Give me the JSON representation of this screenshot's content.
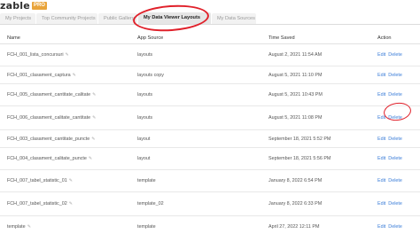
{
  "header": {
    "logo_text": "zable",
    "logo_badge": "PRO"
  },
  "tabs": [
    {
      "label": "My Projects",
      "active": false
    },
    {
      "label": "Top Community Projects",
      "active": false
    },
    {
      "label": "Public Gallery",
      "active": false
    },
    {
      "label": "My Data Viewer Layouts",
      "active": true
    },
    {
      "label": "My Data Sources",
      "active": false
    }
  ],
  "table": {
    "headers": {
      "name": "Name",
      "source": "App Source",
      "time": "Time Saved",
      "action": "Action"
    },
    "edit_label": "Edit",
    "delete_label": "Delete",
    "rows": [
      {
        "name": "FCH_001_lista_concursuri",
        "source": "layouts",
        "time": "August 2, 2021 11:54 AM"
      },
      {
        "name": "FCH_001_clasament_captura",
        "source": "layouts copy",
        "time": "August 5, 2021 11:10 PM"
      },
      {
        "name": "FCH_005_clasament_cantitate_calitate",
        "source": "layouts",
        "time": "August 5, 2021 10:43 PM"
      },
      {
        "name": "FCH_006_clasament_calitate_cantitate",
        "source": "layouts",
        "time": "August 5, 2021 11:08 PM"
      },
      {
        "name": "FCH_003_clasament_cantitate_puncte",
        "source": "layout",
        "time": "September 18, 2021 5:52 PM"
      },
      {
        "name": "FCH_004_clasament_calitate_puncte",
        "source": "layout",
        "time": "September 18, 2021 5:56 PM"
      },
      {
        "name": "FCH_007_tabel_statistic_01",
        "source": "template",
        "time": "January 8, 2022 6:54 PM"
      },
      {
        "name": "FCH_007_tabel_statistic_02",
        "source": "template_02",
        "time": "January 8, 2022 6:33 PM"
      },
      {
        "name": "template",
        "source": "template",
        "time": "April 27, 2022 12:11 PM"
      }
    ]
  }
}
